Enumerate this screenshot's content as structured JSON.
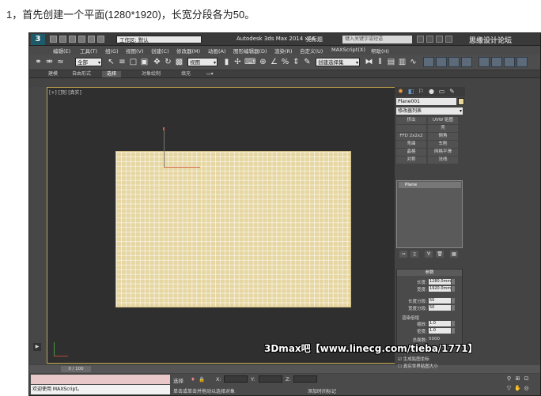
{
  "caption": "1，首先创建一个平面(1280*1920)，长宽分段各为50。",
  "titlebar": {
    "logo": "3",
    "workspace": "工作区: 默认",
    "app_title": "Autodesk 3ds Max  2014 x64",
    "doc_name": "无标题",
    "search_placeholder": "键入关键字或短语",
    "watermark": "思缘设计论坛"
  },
  "menu": [
    "编辑(E)",
    "工具(T)",
    "组(G)",
    "视图(V)",
    "创建(C)",
    "修改器(M)",
    "动画(A)",
    "图形编辑器(D)",
    "渲染(R)",
    "自定义(U)",
    "MAXScript(X)",
    "帮助(H)"
  ],
  "toolbar": {
    "select_filter": "全部",
    "ref_coord": "视图",
    "named_sel": "创建选择集"
  },
  "ribbon": {
    "tabs": [
      "建模",
      "自由形式",
      "选择",
      "对象绘制",
      "填充"
    ],
    "active": 2
  },
  "viewport": {
    "label": "[+] [顶] [真实]"
  },
  "cmdpanel": {
    "object_name": "Plane001",
    "modifier_list": "修改器列表",
    "mod_buttons": [
      "挤出",
      "UVW 贴图",
      "",
      "壳",
      "FFD 2x2x2",
      "倒角",
      "弯曲",
      "车削",
      "晶格",
      "网格平滑",
      "对称",
      "法线"
    ],
    "stack_item": "Plane",
    "params_title": "参数",
    "length_label": "长度:",
    "length_value": "1280.0mm",
    "width_label": "宽度:",
    "width_value": "1920.0mm",
    "length_segs_label": "长度分段:",
    "length_segs": "50",
    "width_segs_label": "宽度分段:",
    "width_segs": "50",
    "render_mult_label": "渲染倍增",
    "scale_label": "缩放:",
    "scale_value": "1.0",
    "density_label": "密度:",
    "density_value": "1.0",
    "total_faces_label": "总面数:",
    "total_faces": "5000",
    "gen_mapping": "生成贴图坐标",
    "real_world": "真实世界贴图大小"
  },
  "timeline": {
    "frame": "0 / 100"
  },
  "status": {
    "script_text": "欢迎使用 MAXScript。",
    "select_label": "选择",
    "x_label": "X:",
    "y_label": "Y:",
    "z_label": "Z:",
    "hint": "单击或单击并拖动以选择对象",
    "add_time": "添加时间标记",
    "overlay": "3Dmax吧【www.linecg.com/tieba/1771】"
  }
}
